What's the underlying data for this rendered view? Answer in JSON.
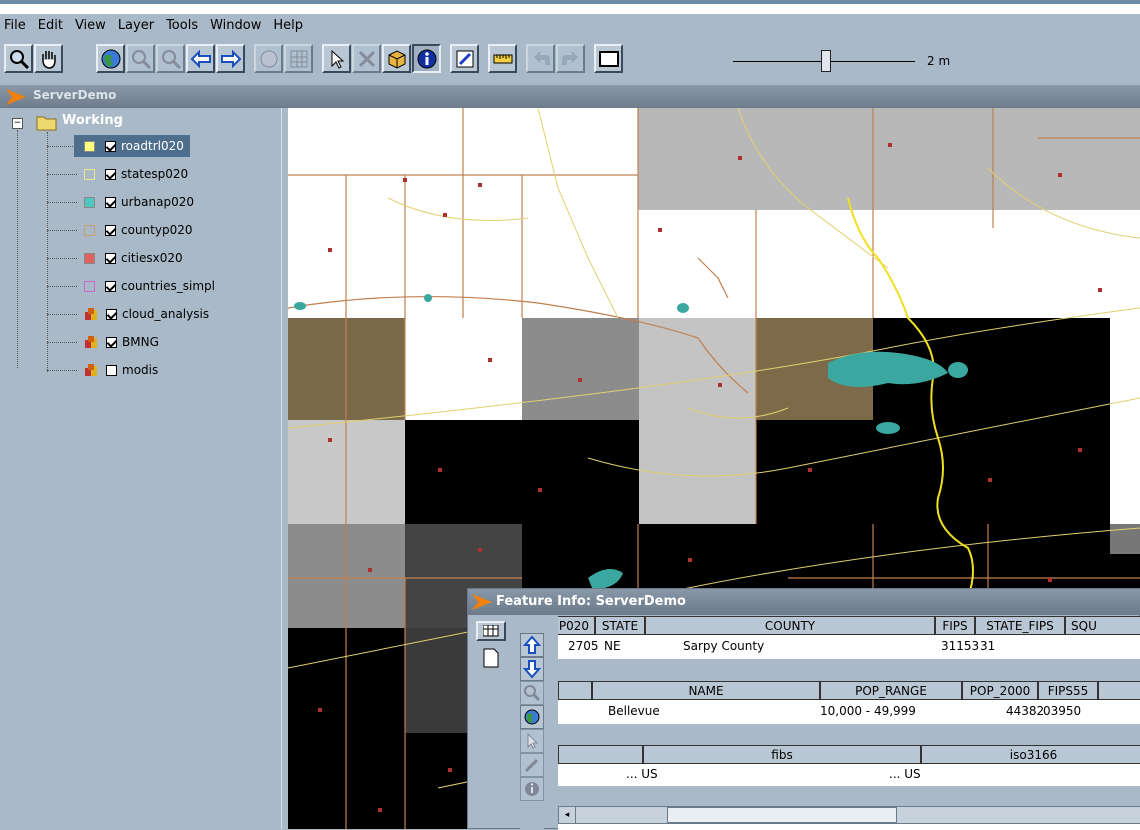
{
  "menu": [
    "File",
    "Edit",
    "View",
    "Layer",
    "Tools",
    "Window",
    "Help"
  ],
  "toolbar": {
    "buttons": [
      "zoom-icon",
      "pan-hand-icon",
      "globe-icon",
      "zoom-in-icon",
      "zoom-out-icon",
      "back-arrow-icon",
      "forward-arrow-icon",
      "palette-icon",
      "grid-icon",
      "select-arrow-icon",
      "tools-icon",
      "box-3d-icon",
      "info-icon",
      "edit-icon",
      "ruler-icon",
      "undo-icon",
      "redo-icon",
      "window-icon"
    ],
    "scale_label": "2 m",
    "scale_fraction": 0.51
  },
  "panel_title": "ServerDemo",
  "tree": {
    "root": "Working",
    "layers": [
      {
        "name": "roadtrl020",
        "checked": true,
        "swatch": "#ffff80",
        "type": "swatch"
      },
      {
        "name": "statesp020",
        "checked": true,
        "swatch": "#e8e890",
        "type": "outline"
      },
      {
        "name": "urbanap020",
        "checked": true,
        "swatch": "#4fc6c0",
        "type": "swatch"
      },
      {
        "name": "countyp020",
        "checked": true,
        "swatch": "#c8a070",
        "type": "outline"
      },
      {
        "name": "citiesx020",
        "checked": true,
        "swatch": "#e06060",
        "type": "swatch"
      },
      {
        "name": "countries_simpl",
        "checked": true,
        "swatch": "#cc66cc",
        "type": "outline"
      },
      {
        "name": "cloud_analysis",
        "checked": true,
        "swatch": "",
        "type": "raster"
      },
      {
        "name": "BMNG",
        "checked": true,
        "swatch": "",
        "type": "raster"
      },
      {
        "name": "modis",
        "checked": false,
        "swatch": "",
        "type": "raster"
      }
    ]
  },
  "feature_info": {
    "title": "Feature Info: ServerDemo",
    "table1": {
      "headers": [
        "P020",
        "STATE",
        "COUNTY",
        "FIPS",
        "STATE_FIPS",
        "SQU"
      ],
      "row": [
        "2705",
        "NE",
        "Sarpy County",
        "31153",
        "31"
      ]
    },
    "table2": {
      "headers": [
        "NAME",
        "POP_RANGE",
        "POP_2000",
        "FIPS55"
      ],
      "row": [
        "Bellevue",
        "10,000 - 49,999",
        "44382",
        "03950"
      ]
    },
    "table3": {
      "headers": [
        "fibs",
        "iso3166"
      ],
      "row": [
        "... US",
        "... US"
      ]
    }
  }
}
